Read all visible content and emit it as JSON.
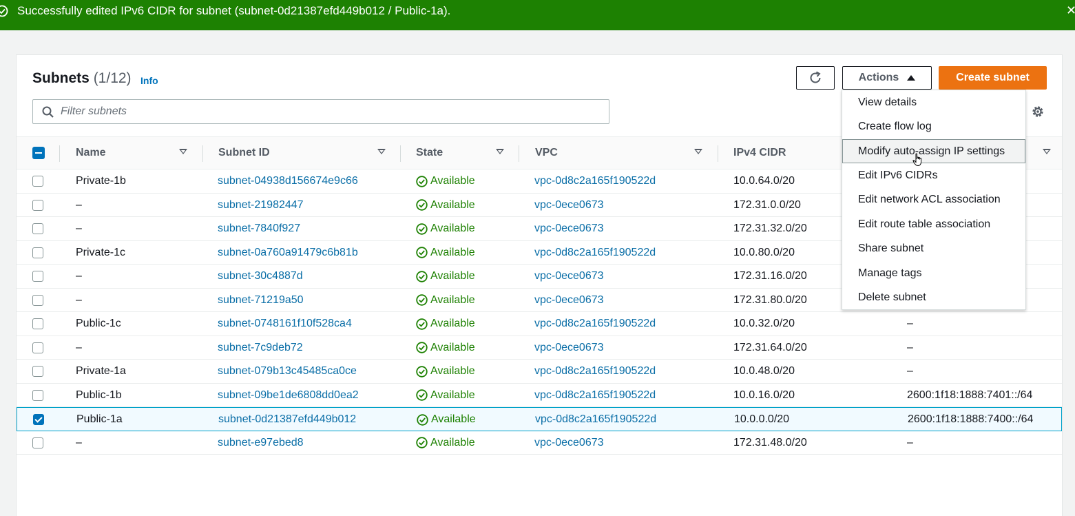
{
  "flash": {
    "message": "Successfully edited IPv6 CIDR for subnet (subnet-0d21387efd449b012 / Public-1a).",
    "close_label": "✕",
    "color": "#1d8102"
  },
  "header": {
    "title": "Subnets",
    "count": "(1/12)",
    "info_label": "Info",
    "actions_label": "Actions",
    "create_label": "Create subnet",
    "accent": "#ec7211"
  },
  "filter": {
    "placeholder": "Filter subnets",
    "value": ""
  },
  "table": {
    "columns": {
      "name": "Name",
      "subnet_id": "Subnet ID",
      "state": "State",
      "vpc": "VPC",
      "ipv4": "IPv4 CIDR"
    },
    "rows": [
      {
        "checked": false,
        "name": "Private-1b",
        "subnet_id": "subnet-04938d156674e9c66",
        "state": "Available",
        "vpc": "vpc-0d8c2a165f190522d",
        "ipv4": "10.0.64.0/20",
        "ipv6": ""
      },
      {
        "checked": false,
        "name": "–",
        "subnet_id": "subnet-21982447",
        "state": "Available",
        "vpc": "vpc-0ece0673",
        "ipv4": "172.31.0.0/20",
        "ipv6": ""
      },
      {
        "checked": false,
        "name": "–",
        "subnet_id": "subnet-7840f927",
        "state": "Available",
        "vpc": "vpc-0ece0673",
        "ipv4": "172.31.32.0/20",
        "ipv6": ""
      },
      {
        "checked": false,
        "name": "Private-1c",
        "subnet_id": "subnet-0a760a91479c6b81b",
        "state": "Available",
        "vpc": "vpc-0d8c2a165f190522d",
        "ipv4": "10.0.80.0/20",
        "ipv6": ""
      },
      {
        "checked": false,
        "name": "–",
        "subnet_id": "subnet-30c4887d",
        "state": "Available",
        "vpc": "vpc-0ece0673",
        "ipv4": "172.31.16.0/20",
        "ipv6": ""
      },
      {
        "checked": false,
        "name": "–",
        "subnet_id": "subnet-71219a50",
        "state": "Available",
        "vpc": "vpc-0ece0673",
        "ipv4": "172.31.80.0/20",
        "ipv6": ""
      },
      {
        "checked": false,
        "name": "Public-1c",
        "subnet_id": "subnet-0748161f10f528ca4",
        "state": "Available",
        "vpc": "vpc-0d8c2a165f190522d",
        "ipv4": "10.0.32.0/20",
        "ipv6": "–"
      },
      {
        "checked": false,
        "name": "–",
        "subnet_id": "subnet-7c9deb72",
        "state": "Available",
        "vpc": "vpc-0ece0673",
        "ipv4": "172.31.64.0/20",
        "ipv6": "–"
      },
      {
        "checked": false,
        "name": "Private-1a",
        "subnet_id": "subnet-079b13c45485ca0ce",
        "state": "Available",
        "vpc": "vpc-0d8c2a165f190522d",
        "ipv4": "10.0.48.0/20",
        "ipv6": "–"
      },
      {
        "checked": false,
        "name": "Public-1b",
        "subnet_id": "subnet-09be1de6808dd0ea2",
        "state": "Available",
        "vpc": "vpc-0d8c2a165f190522d",
        "ipv4": "10.0.16.0/20",
        "ipv6": "2600:1f18:1888:7401::/64"
      },
      {
        "checked": true,
        "name": "Public-1a",
        "subnet_id": "subnet-0d21387efd449b012",
        "state": "Available",
        "vpc": "vpc-0d8c2a165f190522d",
        "ipv4": "10.0.0.0/20",
        "ipv6": "2600:1f18:1888:7400::/64"
      },
      {
        "checked": false,
        "name": "–",
        "subnet_id": "subnet-e97ebed8",
        "state": "Available",
        "vpc": "vpc-0ece0673",
        "ipv4": "172.31.48.0/20",
        "ipv6": "–"
      }
    ]
  },
  "actions_menu": {
    "items": [
      "View details",
      "Create flow log",
      "Modify auto-assign IP settings",
      "Edit IPv6 CIDRs",
      "Edit network ACL association",
      "Edit route table association",
      "Share subnet",
      "Manage tags",
      "Delete subnet"
    ],
    "highlighted": "Modify auto-assign IP settings"
  }
}
